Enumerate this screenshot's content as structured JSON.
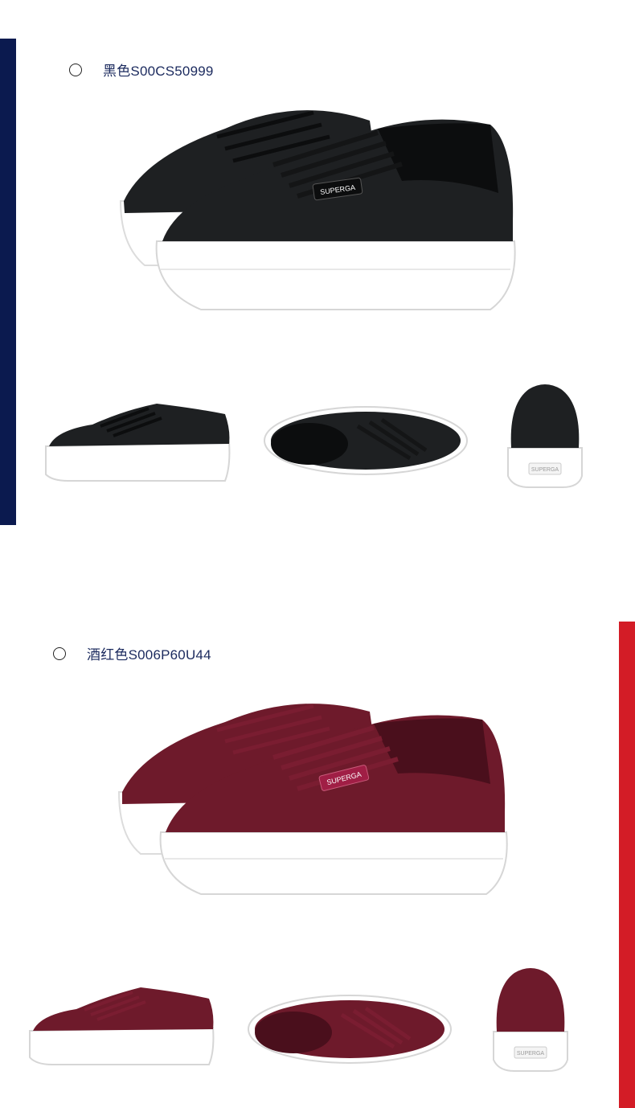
{
  "variants": [
    {
      "label": "黑色S00CS50999",
      "accent_color": "#0b1a4f",
      "upper_color": "#1e2022",
      "upper_shade": "#0c0d0e",
      "lace_color": "#141516",
      "brand_tag": "SUPERGA",
      "sole_tag": "SUPERGA"
    },
    {
      "label": "酒红色S006P60U44",
      "accent_color": "#d31c26",
      "upper_color": "#6e1a2b",
      "upper_shade": "#4a0f1c",
      "lace_color": "#7a1d31",
      "brand_tag": "SUPERGA",
      "sole_tag": "SUPERGA"
    }
  ]
}
